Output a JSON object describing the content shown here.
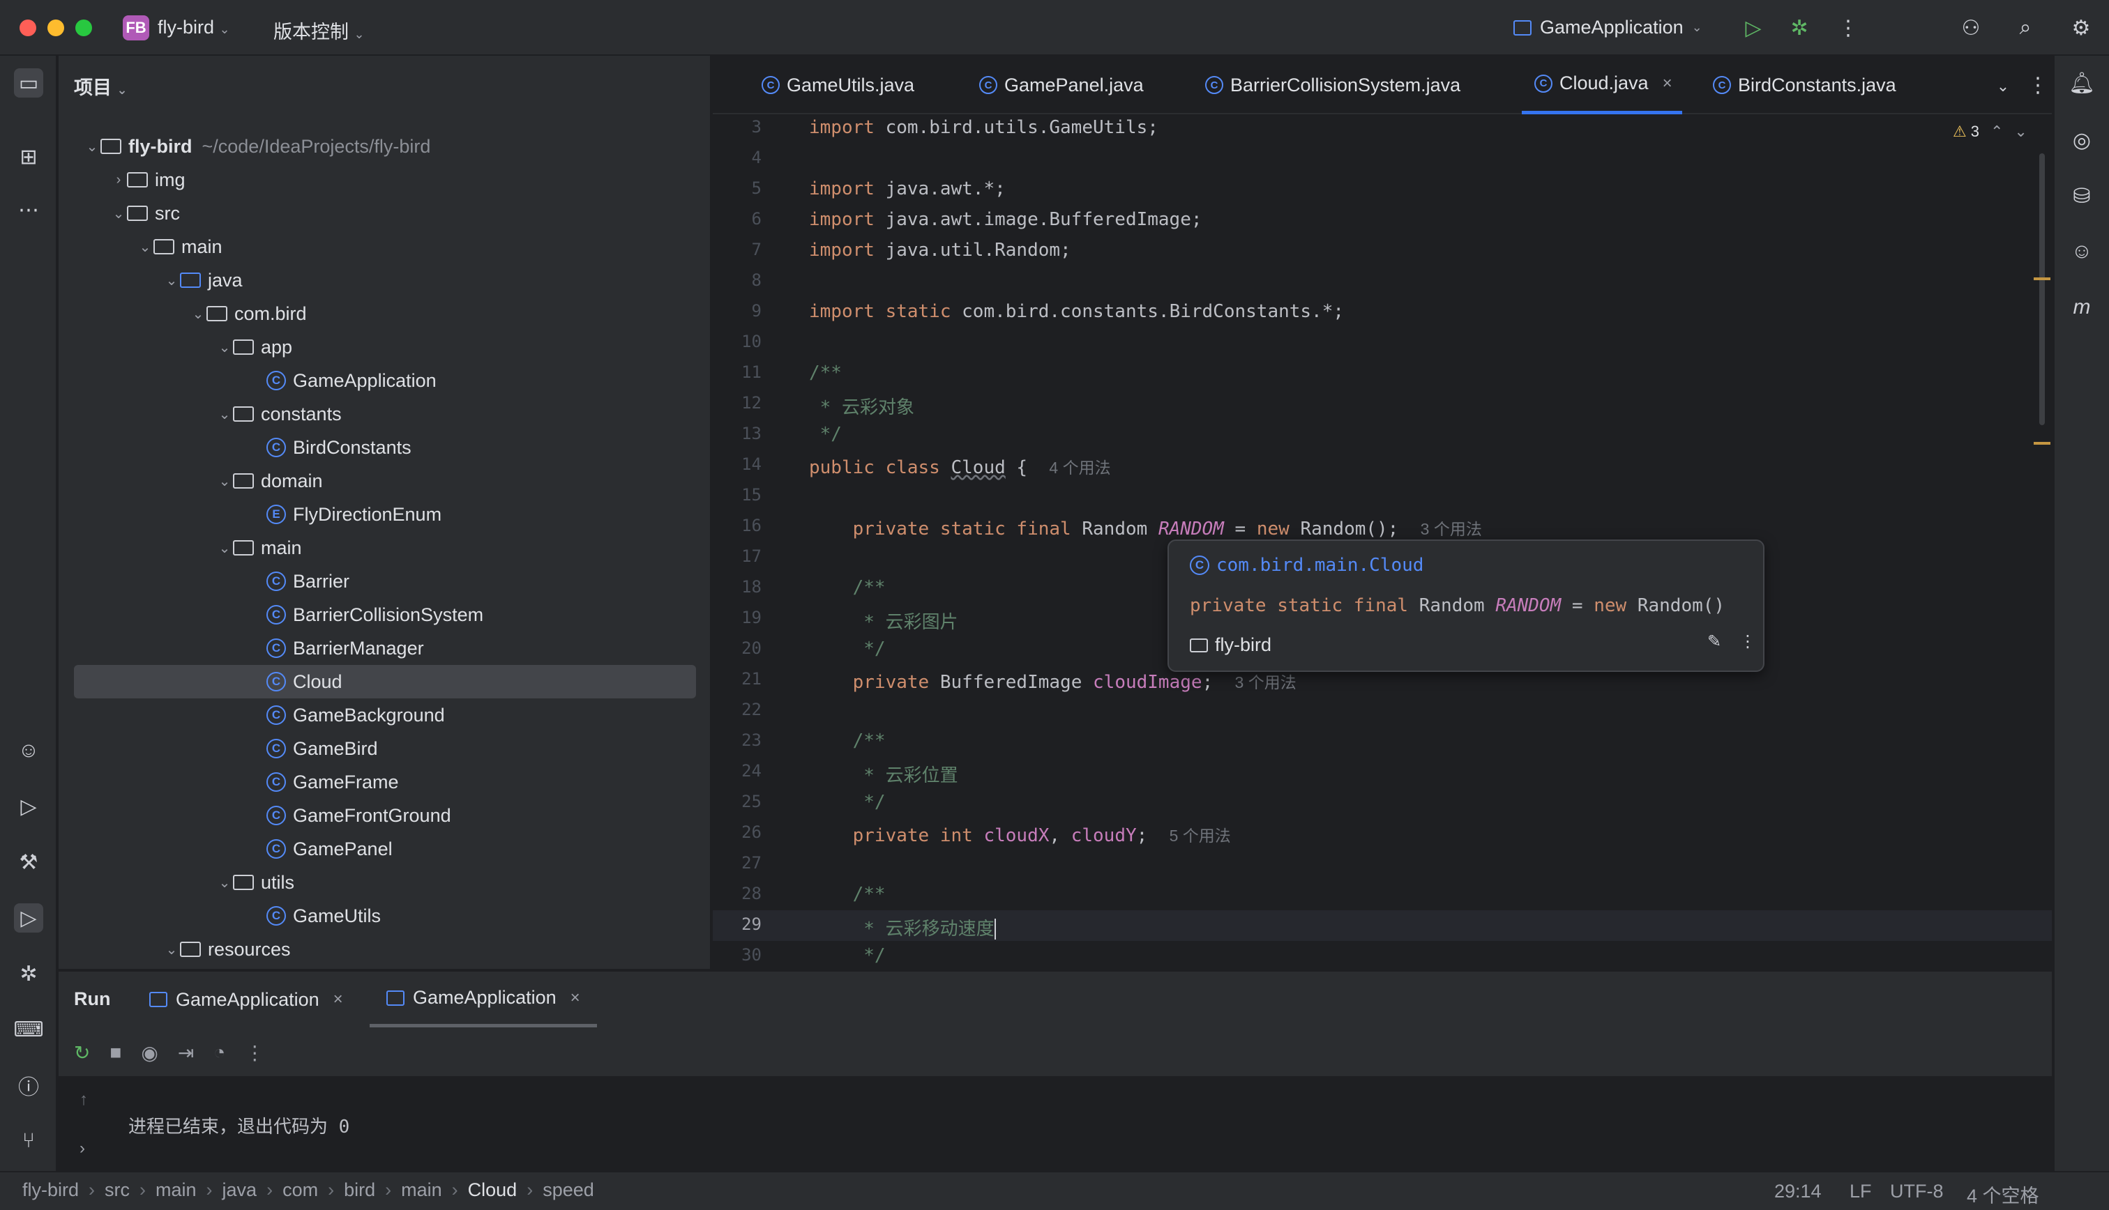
{
  "titlebar": {
    "project_badge": "FB",
    "project_name": "fly-bird",
    "vcs_label": "版本控制",
    "run_config": "GameApplication"
  },
  "project_panel": {
    "header": "项目",
    "tree": [
      {
        "label": "fly-bird",
        "extra": "~/code/IdeaProjects/fly-bird",
        "kind": "module",
        "depth": 0,
        "open": true
      },
      {
        "label": "img",
        "kind": "folder",
        "depth": 1,
        "open": false
      },
      {
        "label": "src",
        "kind": "folder",
        "depth": 1,
        "open": true
      },
      {
        "label": "main",
        "kind": "folder",
        "depth": 2,
        "open": true
      },
      {
        "label": "java",
        "kind": "source-folder",
        "depth": 3,
        "open": true
      },
      {
        "label": "com.bird",
        "kind": "package",
        "depth": 4,
        "open": true
      },
      {
        "label": "app",
        "kind": "package",
        "depth": 5,
        "open": true
      },
      {
        "label": "GameApplication",
        "kind": "class",
        "depth": 6
      },
      {
        "label": "constants",
        "kind": "package",
        "depth": 5,
        "open": true
      },
      {
        "label": "BirdConstants",
        "kind": "class",
        "depth": 6
      },
      {
        "label": "domain",
        "kind": "package",
        "depth": 5,
        "open": true
      },
      {
        "label": "FlyDirectionEnum",
        "kind": "enum",
        "depth": 6
      },
      {
        "label": "main",
        "kind": "package",
        "depth": 5,
        "open": true
      },
      {
        "label": "Barrier",
        "kind": "class",
        "depth": 6
      },
      {
        "label": "BarrierCollisionSystem",
        "kind": "class",
        "depth": 6
      },
      {
        "label": "BarrierManager",
        "kind": "class",
        "depth": 6
      },
      {
        "label": "Cloud",
        "kind": "class",
        "depth": 6,
        "selected": true
      },
      {
        "label": "GameBackground",
        "kind": "class",
        "depth": 6
      },
      {
        "label": "GameBird",
        "kind": "class",
        "depth": 6
      },
      {
        "label": "GameFrame",
        "kind": "class",
        "depth": 6
      },
      {
        "label": "GameFrontGround",
        "kind": "class",
        "depth": 6
      },
      {
        "label": "GamePanel",
        "kind": "class",
        "depth": 6
      },
      {
        "label": "utils",
        "kind": "package",
        "depth": 5,
        "open": true
      },
      {
        "label": "GameUtils",
        "kind": "class",
        "depth": 6
      },
      {
        "label": "resources",
        "kind": "folder",
        "depth": 3,
        "open": true
      }
    ]
  },
  "editor": {
    "tabs": [
      {
        "label": "GameUtils.java",
        "active": false
      },
      {
        "label": "GamePanel.java",
        "active": false
      },
      {
        "label": "BarrierCollisionSystem.java",
        "active": false
      },
      {
        "label": "Cloud.java",
        "active": true
      },
      {
        "label": "BirdConstants.java",
        "active": false
      }
    ],
    "warnings_count": "3",
    "current_line": 29,
    "lines": [
      {
        "n": 3,
        "html": "<span class='kw'>import</span> com.bird.utils.GameUtils;"
      },
      {
        "n": 4,
        "html": ""
      },
      {
        "n": 5,
        "html": "<span class='kw'>import</span> java.awt.*;"
      },
      {
        "n": 6,
        "html": "<span class='kw'>import</span> java.awt.image.BufferedImage;"
      },
      {
        "n": 7,
        "html": "<span class='kw'>import</span> java.util.Random;"
      },
      {
        "n": 8,
        "html": ""
      },
      {
        "n": 9,
        "html": "<span class='kw'>import static</span> com.bird.constants.BirdConstants.*;"
      },
      {
        "n": 10,
        "html": ""
      },
      {
        "n": 11,
        "html": "<span class='cmt'>/**</span>"
      },
      {
        "n": 12,
        "html": "<span class='cmt'> * 云彩对象</span>"
      },
      {
        "n": 13,
        "html": "<span class='cmt'> */</span>"
      },
      {
        "n": 14,
        "html": "<span class='kw'>public class</span> <span class='cls'>Cloud</span> {  <span class='hint'>4 个用法</span>"
      },
      {
        "n": 15,
        "html": ""
      },
      {
        "n": 16,
        "html": "    <span class='kw'>private static final</span> Random <span class='fldi'>RANDOM</span> = <span class='kw'>new</span> Random();  <span class='hint'>3 个用法</span>"
      },
      {
        "n": 17,
        "html": ""
      },
      {
        "n": 18,
        "html": "    <span class='cmt'>/**</span>"
      },
      {
        "n": 19,
        "html": "    <span class='cmt'> * 云彩图片</span>"
      },
      {
        "n": 20,
        "html": "    <span class='cmt'> */</span>"
      },
      {
        "n": 21,
        "html": "    <span class='kw'>private</span> BufferedImage <span class='fld'>cloudImage</span>;  <span class='hint'>3 个用法</span>"
      },
      {
        "n": 22,
        "html": ""
      },
      {
        "n": 23,
        "html": "    <span class='cmt'>/**</span>"
      },
      {
        "n": 24,
        "html": "    <span class='cmt'> * 云彩位置</span>"
      },
      {
        "n": 25,
        "html": "    <span class='cmt'> */</span>"
      },
      {
        "n": 26,
        "html": "    <span class='kw'>private int</span> <span class='fld'>cloudX</span>, <span class='fld'>cloudY</span>;  <span class='hint'>5 个用法</span>"
      },
      {
        "n": 27,
        "html": ""
      },
      {
        "n": 28,
        "html": "    <span class='cmt'>/**</span>"
      },
      {
        "n": 29,
        "html": "    <span class='cmt'> * 云彩移动速度</span><span style='border-left:2px solid #ced0d6'></span>"
      },
      {
        "n": 30,
        "html": "    <span class='cmt'> */</span>"
      }
    ]
  },
  "popup": {
    "qualified_name": "com.bird.main.Cloud",
    "declaration": "private static final Random RANDOM = new Random()",
    "module": "fly-bird"
  },
  "run_panel": {
    "title": "Run",
    "tabs": [
      {
        "label": "GameApplication",
        "active": false
      },
      {
        "label": "GameApplication",
        "active": true
      }
    ],
    "console_output": "进程已结束，退出代码为 0"
  },
  "statusbar": {
    "breadcrumbs": [
      "fly-bird",
      "src",
      "main",
      "java",
      "com",
      "bird",
      "main",
      "Cloud",
      "speed"
    ],
    "position": "29:14",
    "line_separator": "LF",
    "encoding": "UTF-8",
    "indent": "4 个空格"
  },
  "colors": {
    "accent": "#3574f0",
    "bg_editor": "#1e1f22",
    "bg_panel": "#2b2d30",
    "keyword": "#cf8e6d",
    "field": "#c77dbb",
    "doc_comment": "#5f826b"
  }
}
